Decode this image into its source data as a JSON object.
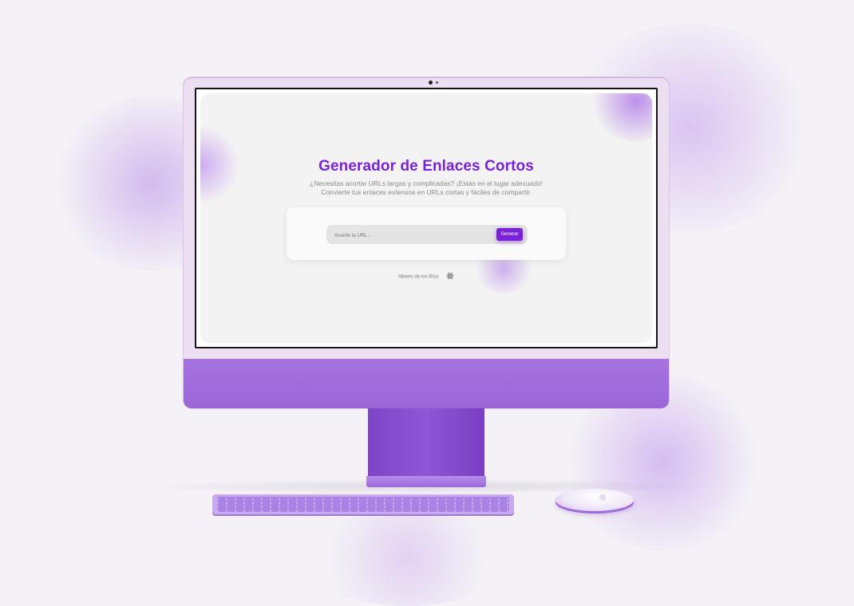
{
  "page": {
    "title": "Generador de Enlaces Cortos",
    "subtitle_line1": "¿Necesitas acortar URLs largas y complicadas? ¡Estás en el lugar adecuado!",
    "subtitle_line2": "Convierte tus enlaces extensos en URLs cortas y fáciles de compartir."
  },
  "form": {
    "url_placeholder": "Inserte la URL...",
    "url_value": "",
    "generate_label": "Generar"
  },
  "footer": {
    "author": "Alberto de los Ríos",
    "icon": "react-icon"
  },
  "colors": {
    "accent": "#7b22d8",
    "device": "#9c66d8"
  }
}
